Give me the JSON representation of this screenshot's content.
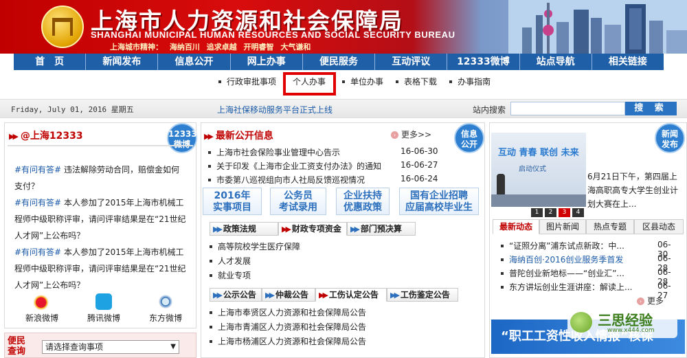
{
  "header": {
    "title": "上海市人力资源和社会保障局",
    "title_en": "SHANGHAI MUNICIPAL HUMAN RESOURCES AND SOCIAL SECURITY BUREAU",
    "motto": "上海城市精神：  海纳百川    追求卓越    开明睿智    大气谦和"
  },
  "nav": {
    "items": [
      "首　页",
      "新闻发布",
      "信息公开",
      "网上办事",
      "便民服务",
      "互动评议",
      "12333微博",
      "站点导航",
      "相关链接"
    ]
  },
  "subnav": {
    "items": [
      "行政审批事项",
      "个人办事",
      "单位办事",
      "表格下载",
      "办事指南"
    ],
    "active": "个人办事"
  },
  "datebar": {
    "date": "Friday, July 01, 2016 星期五",
    "announcement": "上海社保移动服务平台正式上线",
    "search_label": "站内搜索",
    "search_placeholder": "",
    "search_button": "搜 索"
  },
  "weibo": {
    "title": "@上海12333",
    "badge": [
      "12333",
      "微博"
    ],
    "posts": [
      {
        "tag": "#有问有答#",
        "text": "违法解除劳动合同，赔偿金如何支付？"
      },
      {
        "tag": "#有问有答#",
        "text": "本人参加了2015年上海市机械工程师中级职称评审，请问评审结果是在“21世纪人才网”上公布吗？"
      },
      {
        "tag": "#有问有答#",
        "text": "本人参加了2015年上海市机械工程师中级职称评审，请问评审结果是在“21世纪人才网”上公布吗？"
      }
    ],
    "share": [
      "新浪微博",
      "腾讯微博",
      "东方微博"
    ]
  },
  "bianmin": {
    "label": [
      "便民",
      "查询"
    ],
    "select_value": "请选择查询事项"
  },
  "info": {
    "title": "最新公开信息",
    "more": "更多>>",
    "badge": [
      "信息",
      "公开"
    ],
    "items": [
      {
        "text": "上海市社会保险事业管理中心告示",
        "date": "16-06-30"
      },
      {
        "text": "关于印发《上海市企业工资支付办法》的通知",
        "date": "16-06-27"
      },
      {
        "text": "市委第八巡视组向市人社局反馈巡视情况",
        "date": "16-06-24"
      }
    ],
    "promos": [
      [
        "2016年",
        "实事项目"
      ],
      [
        "公务员",
        "考试录用"
      ],
      [
        "企业扶持",
        "优惠政策"
      ],
      [
        "国有企业招聘",
        "应届高校毕业生"
      ]
    ]
  },
  "policy": {
    "tabs": [
      "政策法规",
      "财政专项资金",
      "部门预决算"
    ],
    "items": [
      "高等院校学生医疗保障",
      "人才发展",
      "就业专项"
    ]
  },
  "notice": {
    "tabs": [
      "公示公告",
      "仲裁公告",
      "工伤认定公告",
      "工伤鉴定公告"
    ],
    "items": [
      "上海市奉贤区人力资源和社会保障局公告",
      "上海市青浦区人力资源和社会保障局公告",
      "上海市杨浦区人力资源和社会保障局公告"
    ]
  },
  "news": {
    "badge": [
      "新闻",
      "发布"
    ],
    "photo_caption": "互动 青春 联创 未来",
    "photo_sub": "启动仪式",
    "pages": [
      "1",
      "2",
      "3",
      "4"
    ],
    "active_page": "3",
    "lead": "6月21日下午，第四届上海高职高专大学生创业计划大赛在上...",
    "tabs": [
      "最新动态",
      "图片新闻",
      "热点专题",
      "区县动态"
    ],
    "items": [
      {
        "text": "“证照分离”浦东试点新政：中...",
        "date": "06-30"
      },
      {
        "text": "海纳百创·2016创业服务季首发",
        "date": "06-28"
      },
      {
        "text": "普陀创业新地标——“创业汇”...",
        "date": "06-28"
      },
      {
        "text": "东方讲坛创业生涯讲座：解读上...",
        "date": "06-27"
      }
    ],
    "more": "更多",
    "banner": "“职工工资性收入情报”核保"
  },
  "watermark": {
    "brand": "三思经验",
    "url": "www.x444.com"
  },
  "colors": {
    "brand_red": "#c00000",
    "nav_blue": "#1f5fa8",
    "link_blue": "#1a5aa8"
  }
}
